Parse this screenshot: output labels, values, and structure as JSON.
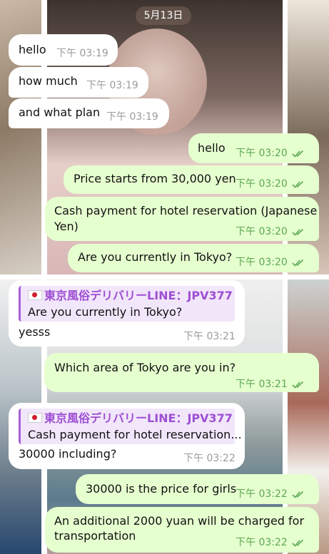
{
  "date": "5月13日",
  "messages": [
    {
      "dir": "in",
      "text": "hello",
      "time": "下午 03:19"
    },
    {
      "dir": "in",
      "text": "how much",
      "time": "下午 03:19"
    },
    {
      "dir": "in",
      "text": "and what plan",
      "time": "下午 03:19"
    },
    {
      "dir": "out",
      "text": "hello",
      "time": "下午 03:20"
    },
    {
      "dir": "out",
      "text": "Price starts from 30,000 yen",
      "time": "下午 03:20"
    },
    {
      "dir": "out",
      "text_line1": "Cash payment for hotel reservation (Japanese",
      "text_line2": "Yen)",
      "time": "下午 03:20"
    },
    {
      "dir": "out",
      "text": "Are you currently in Tokyo?",
      "time": "下午 03:20"
    },
    {
      "dir": "in",
      "reply_name": "東京風俗デリバリーLINE：JPV377",
      "reply_text": "Are you currently in Tokyo?",
      "text": "yesss",
      "time": "下午 03:21"
    },
    {
      "dir": "out",
      "text": "Which area of Tokyo are you in?",
      "time": "下午 03:21"
    },
    {
      "dir": "in",
      "reply_name": "東京風俗デリバリーLINE：JPV377",
      "reply_text": "Cash payment for hotel reservation...",
      "text": "30000 including?",
      "time": "下午 03:22"
    },
    {
      "dir": "out",
      "text": "30000 is the price for girls",
      "time": "下午 03:22"
    },
    {
      "dir": "out",
      "text_line1": "An additional 2000 yuan will be charged for",
      "text_line2": "transportation",
      "time": "下午 03:22"
    }
  ],
  "colors": {
    "incoming": "#ffffff",
    "outgoing": "#e6ffcf",
    "time_out": "#5ca853",
    "reply_accent": "#9e4fd3"
  }
}
